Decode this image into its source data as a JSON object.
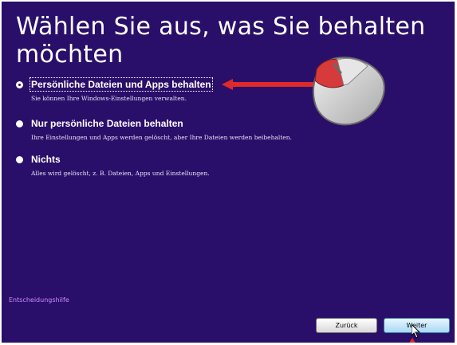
{
  "title": "Wählen Sie aus, was Sie behalten möchten",
  "options": [
    {
      "label": "Persönliche Dateien und Apps behalten",
      "description": "Sie können Ihre Windows-Einstellungen verwalten.",
      "selected": true
    },
    {
      "label": "Nur persönliche Dateien behalten",
      "description": "Ihre Einstellungen und Apps werden gelöscht, aber Ihre Dateien werden beibehalten.",
      "selected": false
    },
    {
      "label": "Nichts",
      "description": "Alles wird gelöscht, z. B. Dateien, Apps und Einstellungen.",
      "selected": false
    }
  ],
  "help_link": "Entscheidungshilfe",
  "buttons": {
    "back": "Zurück",
    "next": "Weiter"
  },
  "colors": {
    "background": "#2a0f6a",
    "link": "#c68cff",
    "arrow": "#e0292b"
  },
  "icons": [
    "mouse-icon",
    "red-arrow-icon",
    "mouse-cursor-icon"
  ]
}
